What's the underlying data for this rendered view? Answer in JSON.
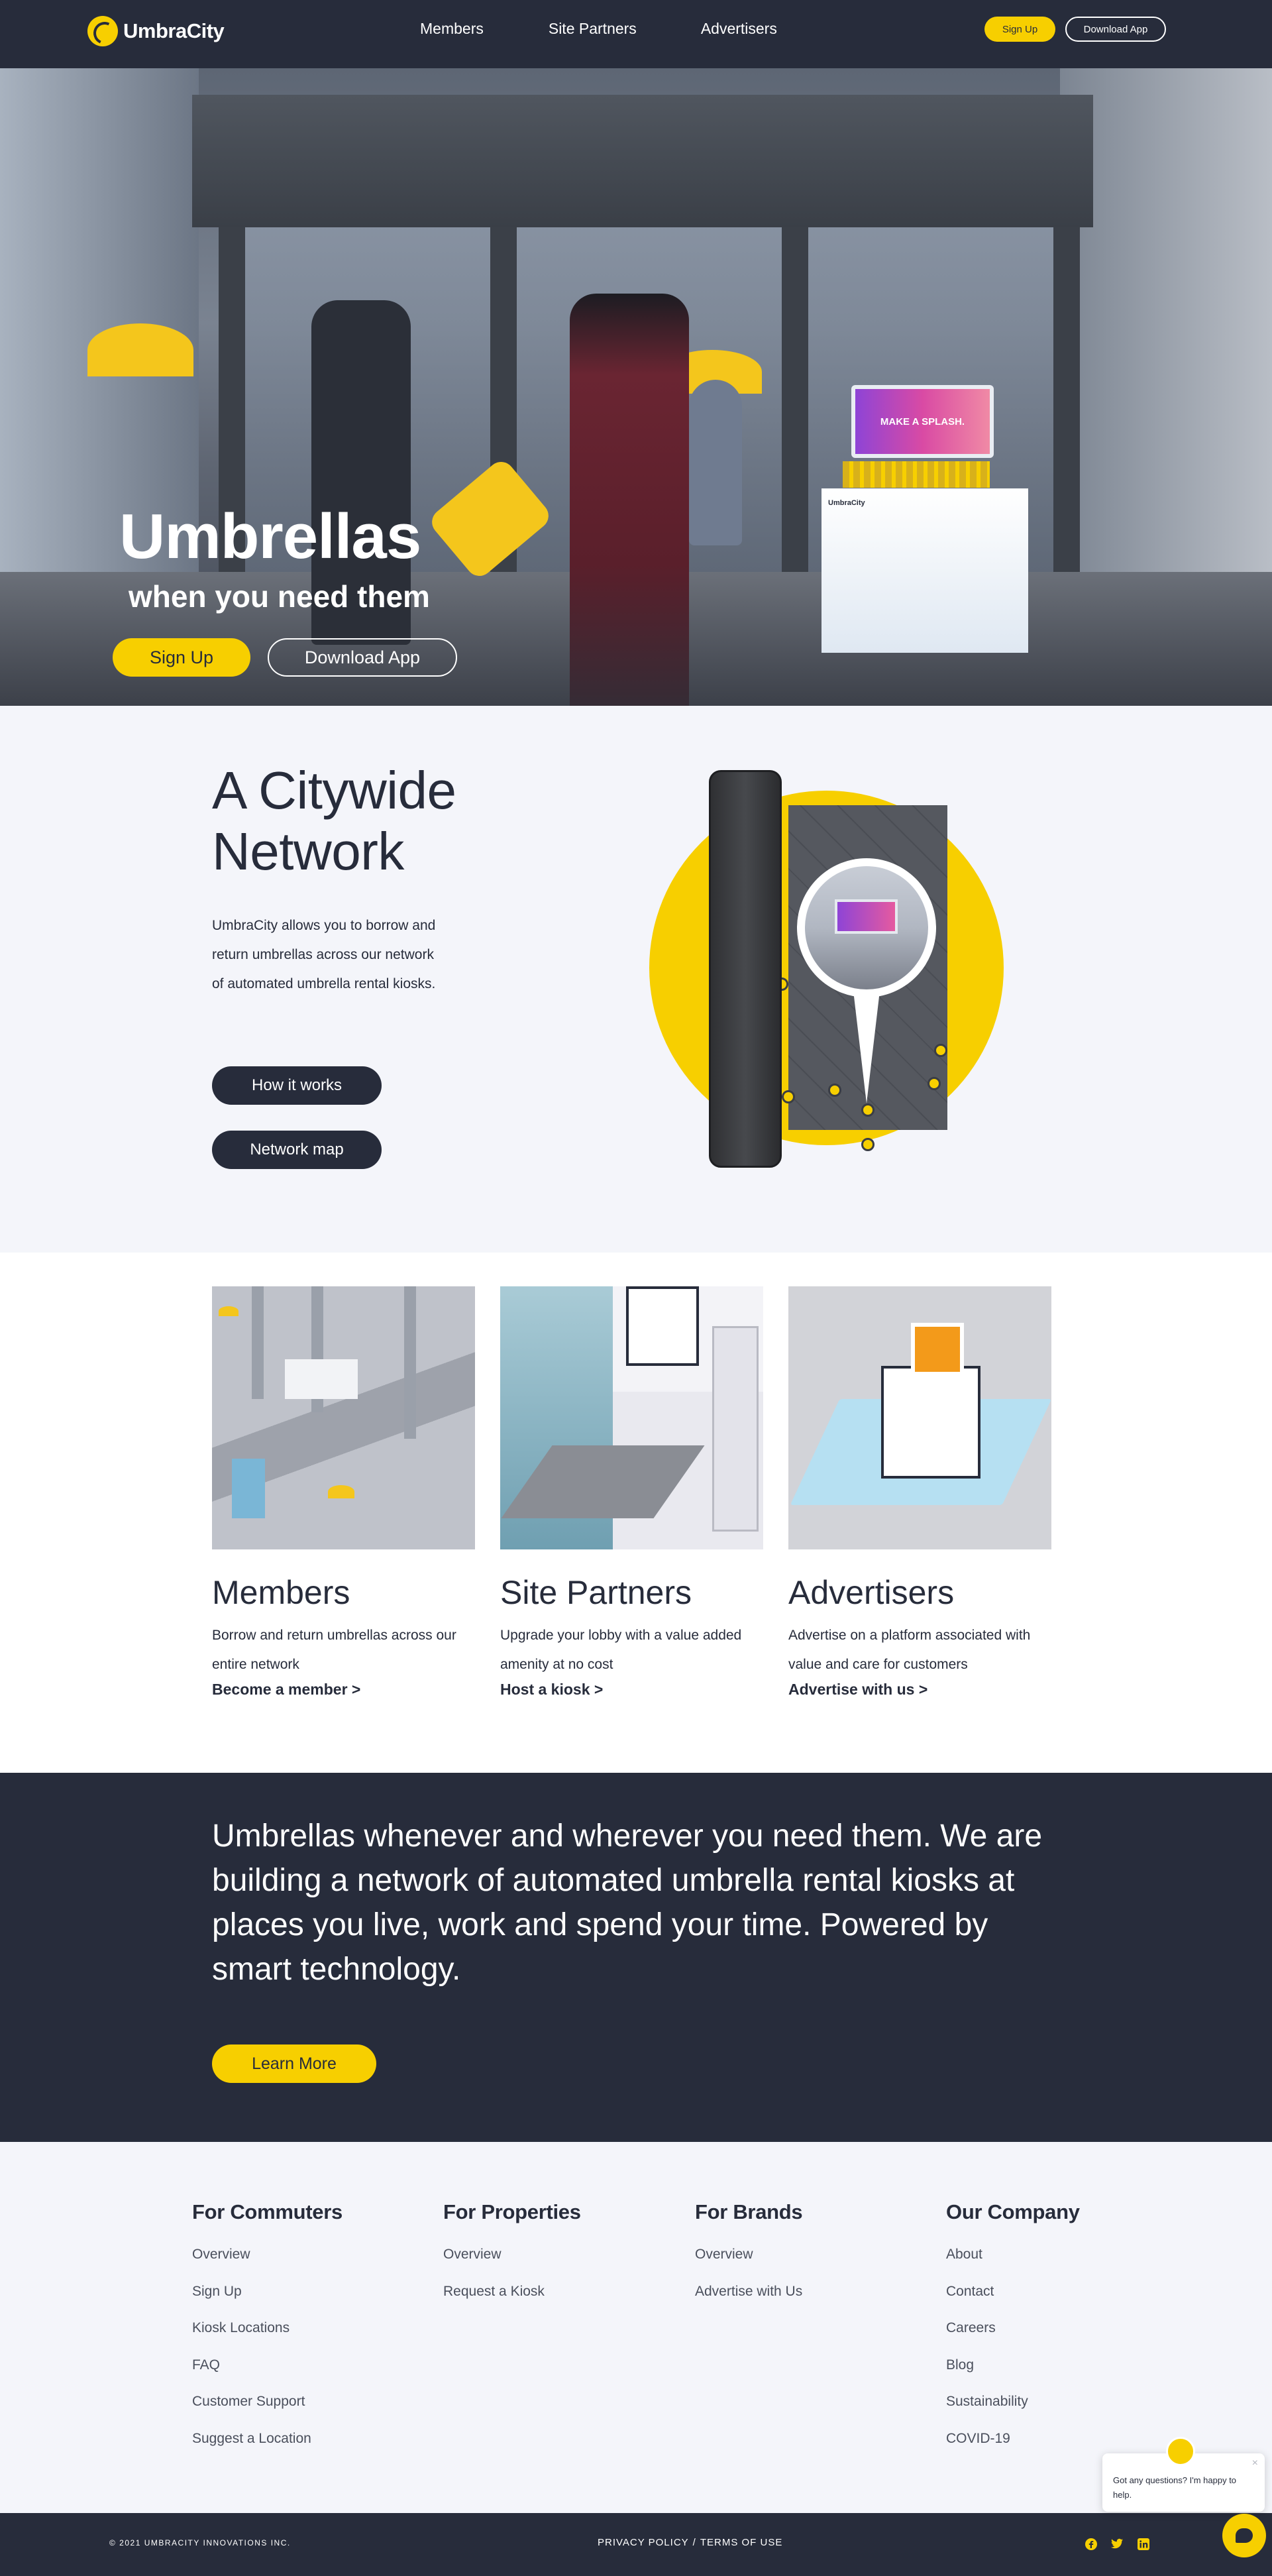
{
  "brand": {
    "name": "UmbraCity",
    "accent": "#f7cf00",
    "dark": "#272c3b"
  },
  "nav": {
    "links": [
      "Members",
      "Site Partners",
      "Advertisers"
    ],
    "signup": "Sign Up",
    "download": "Download App"
  },
  "hero": {
    "title": "Umbrellas",
    "subtitle": "when you need them",
    "signup": "Sign Up",
    "download": "Download App",
    "kiosk_screen_text": "MAKE A SPLASH.",
    "kiosk_logo": "UmbraCity"
  },
  "citywide": {
    "title_line1": "A Citywide",
    "title_line2": "Network",
    "body": "UmbraCity allows you to borrow and return umbrellas across our network of automated umbrella rental kiosks.",
    "btn_how": "How it works",
    "btn_map": "Network map"
  },
  "cards": [
    {
      "title": "Members",
      "body": "Borrow and return umbrellas across our entire network",
      "link": "Become a member >"
    },
    {
      "title": "Site Partners",
      "body": "Upgrade your lobby with a value added amenity at no cost",
      "link": "Host a kiosk >"
    },
    {
      "title": "Advertisers",
      "body": "Advertise on a platform associated with value and care for customers",
      "link": "Advertise with us >"
    }
  ],
  "mission": {
    "text": "Umbrellas whenever and wherever you need them. We are building a network of automated umbrella rental kiosks at places you live, work and spend your time. Powered by smart technology.",
    "button": "Learn More"
  },
  "footer": {
    "columns": [
      {
        "title": "For Commuters",
        "links": [
          "Overview",
          "Sign Up",
          "Kiosk Locations",
          "FAQ",
          "Customer Support",
          "Suggest a Location"
        ]
      },
      {
        "title": "For Properties",
        "links": [
          "Overview",
          "Request a Kiosk"
        ]
      },
      {
        "title": "For Brands",
        "links": [
          "Overview",
          "Advertise with Us"
        ]
      },
      {
        "title": "Our Company",
        "links": [
          "About",
          "Contact",
          "Careers",
          "Blog",
          "Sustainability",
          "COVID-19"
        ]
      }
    ]
  },
  "chat": {
    "message": "Got any questions? I'm happy to help.",
    "close": "×"
  },
  "bottom": {
    "copyright": "© 2021 UMBRACITY INNOVATIONS INC.",
    "privacy": "PRIVACY POLICY",
    "separator": "/",
    "terms": "TERMS OF USE",
    "social_icons": [
      "facebook-icon",
      "twitter-icon",
      "linkedin-icon"
    ]
  }
}
